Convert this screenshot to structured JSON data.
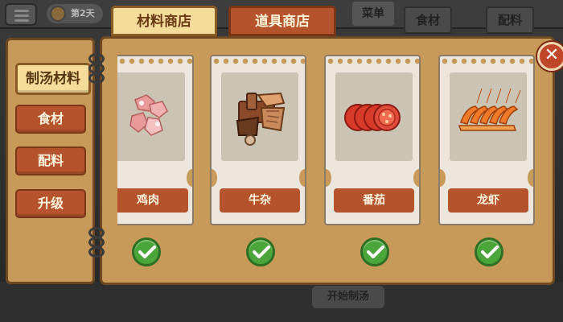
{
  "background": {
    "day_label": "第2天",
    "shelf_labels": [
      "食材",
      "配料"
    ],
    "start_button_label": "开始制汤",
    "top_right_label": "菜单"
  },
  "top_tabs": [
    {
      "label": "材料商店",
      "active": true
    },
    {
      "label": "道具商店",
      "active": false
    }
  ],
  "sidebar": {
    "items": [
      {
        "label": "制汤材料",
        "active": true
      },
      {
        "label": "食材",
        "active": false
      },
      {
        "label": "配料",
        "active": false
      },
      {
        "label": "升级",
        "active": false
      }
    ]
  },
  "cards": [
    {
      "name": "鸡肉",
      "icon": "chicken-meat-icon",
      "purchased": true
    },
    {
      "name": "牛杂",
      "icon": "beef-offal-icon",
      "purchased": true
    },
    {
      "name": "番茄",
      "icon": "tomato-slices-icon",
      "purchased": true
    },
    {
      "name": "龙虾",
      "icon": "shrimp-icon",
      "purchased": true
    }
  ],
  "colors": {
    "panel": "#c79a5a",
    "tab_active": "#f5dc9a",
    "tab_inactive": "#b5542c",
    "check": "#4aa63a",
    "close": "#c0462a"
  }
}
